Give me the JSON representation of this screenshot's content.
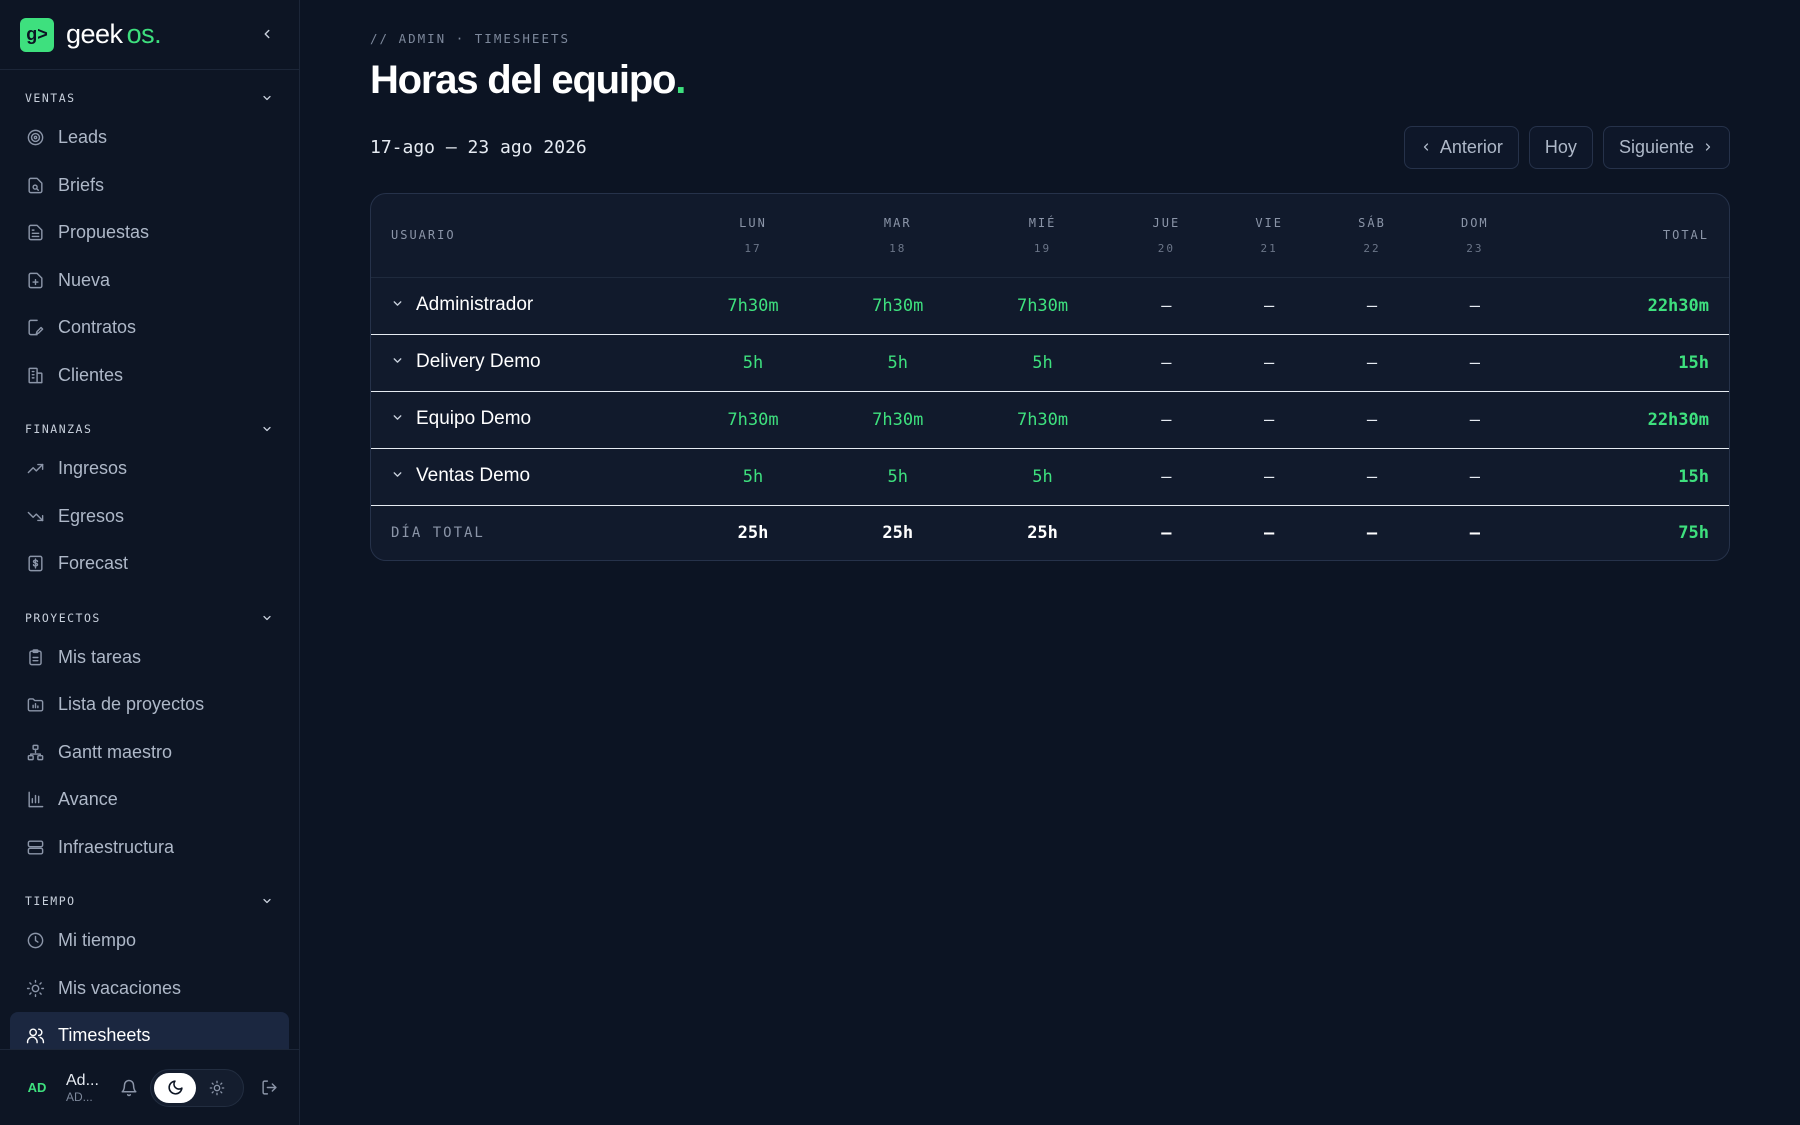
{
  "brand": {
    "logo_glyph": "g>",
    "name": "geek",
    "suffix": "os",
    "dot": "."
  },
  "sidebar": {
    "sections": [
      {
        "label": "VENTAS",
        "items": [
          {
            "label": "Leads",
            "icon": "target-icon"
          },
          {
            "label": "Briefs",
            "icon": "file-search-icon"
          },
          {
            "label": "Propuestas",
            "icon": "file-text-icon"
          },
          {
            "label": "Nueva",
            "icon": "file-plus-icon"
          },
          {
            "label": "Contratos",
            "icon": "file-signature-icon"
          },
          {
            "label": "Clientes",
            "icon": "building-icon"
          }
        ]
      },
      {
        "label": "FINANZAS",
        "items": [
          {
            "label": "Ingresos",
            "icon": "trending-up-icon"
          },
          {
            "label": "Egresos",
            "icon": "trending-down-icon"
          },
          {
            "label": "Forecast",
            "icon": "dollar-file-icon"
          }
        ]
      },
      {
        "label": "PROYECTOS",
        "items": [
          {
            "label": "Mis tareas",
            "icon": "clipboard-icon"
          },
          {
            "label": "Lista de proyectos",
            "icon": "folder-chart-icon"
          },
          {
            "label": "Gantt maestro",
            "icon": "hierarchy-icon"
          },
          {
            "label": "Avance",
            "icon": "bar-chart-icon"
          },
          {
            "label": "Infraestructura",
            "icon": "server-icon"
          }
        ]
      },
      {
        "label": "TIEMPO",
        "items": [
          {
            "label": "Mi tiempo",
            "icon": "clock-icon"
          },
          {
            "label": "Mis vacaciones",
            "icon": "sun-icon"
          },
          {
            "label": "Timesheets",
            "icon": "users-icon",
            "active": true
          }
        ]
      }
    ],
    "footer": {
      "avatar": "AD",
      "user_name": "Ad...",
      "user_sub": "AD..."
    }
  },
  "main": {
    "breadcrumb": "// ADMIN · TIMESHEETS",
    "title": "Horas del equipo",
    "title_dot": ".",
    "date_range": "17-ago — 23 ago 2026",
    "buttons": {
      "prev": "Anterior",
      "today": "Hoy",
      "next": "Siguiente"
    }
  },
  "table": {
    "user_header": "USUARIO",
    "total_header": "TOTAL",
    "days": [
      {
        "name": "LUN",
        "num": "17"
      },
      {
        "name": "MAR",
        "num": "18"
      },
      {
        "name": "MIÉ",
        "num": "19"
      },
      {
        "name": "JUE",
        "num": "20"
      },
      {
        "name": "VIE",
        "num": "21"
      },
      {
        "name": "SÁB",
        "num": "22"
      },
      {
        "name": "DOM",
        "num": "23"
      }
    ],
    "rows": [
      {
        "name": "Administrador",
        "values": [
          "7h30m",
          "7h30m",
          "7h30m",
          "—",
          "—",
          "—",
          "—"
        ],
        "total": "22h30m"
      },
      {
        "name": "Delivery Demo",
        "values": [
          "5h",
          "5h",
          "5h",
          "—",
          "—",
          "—",
          "—"
        ],
        "total": "15h"
      },
      {
        "name": "Equipo Demo",
        "values": [
          "7h30m",
          "7h30m",
          "7h30m",
          "—",
          "—",
          "—",
          "—"
        ],
        "total": "22h30m"
      },
      {
        "name": "Ventas Demo",
        "values": [
          "5h",
          "5h",
          "5h",
          "—",
          "—",
          "—",
          "—"
        ],
        "total": "15h"
      }
    ],
    "footer": {
      "label": "DÍA TOTAL",
      "values": [
        "25h",
        "25h",
        "25h",
        "—",
        "—",
        "—",
        "—"
      ],
      "total": "75h"
    }
  },
  "colors": {
    "accent": "#3ee07e",
    "background": "#0c1423",
    "surface": "#111a2c"
  }
}
